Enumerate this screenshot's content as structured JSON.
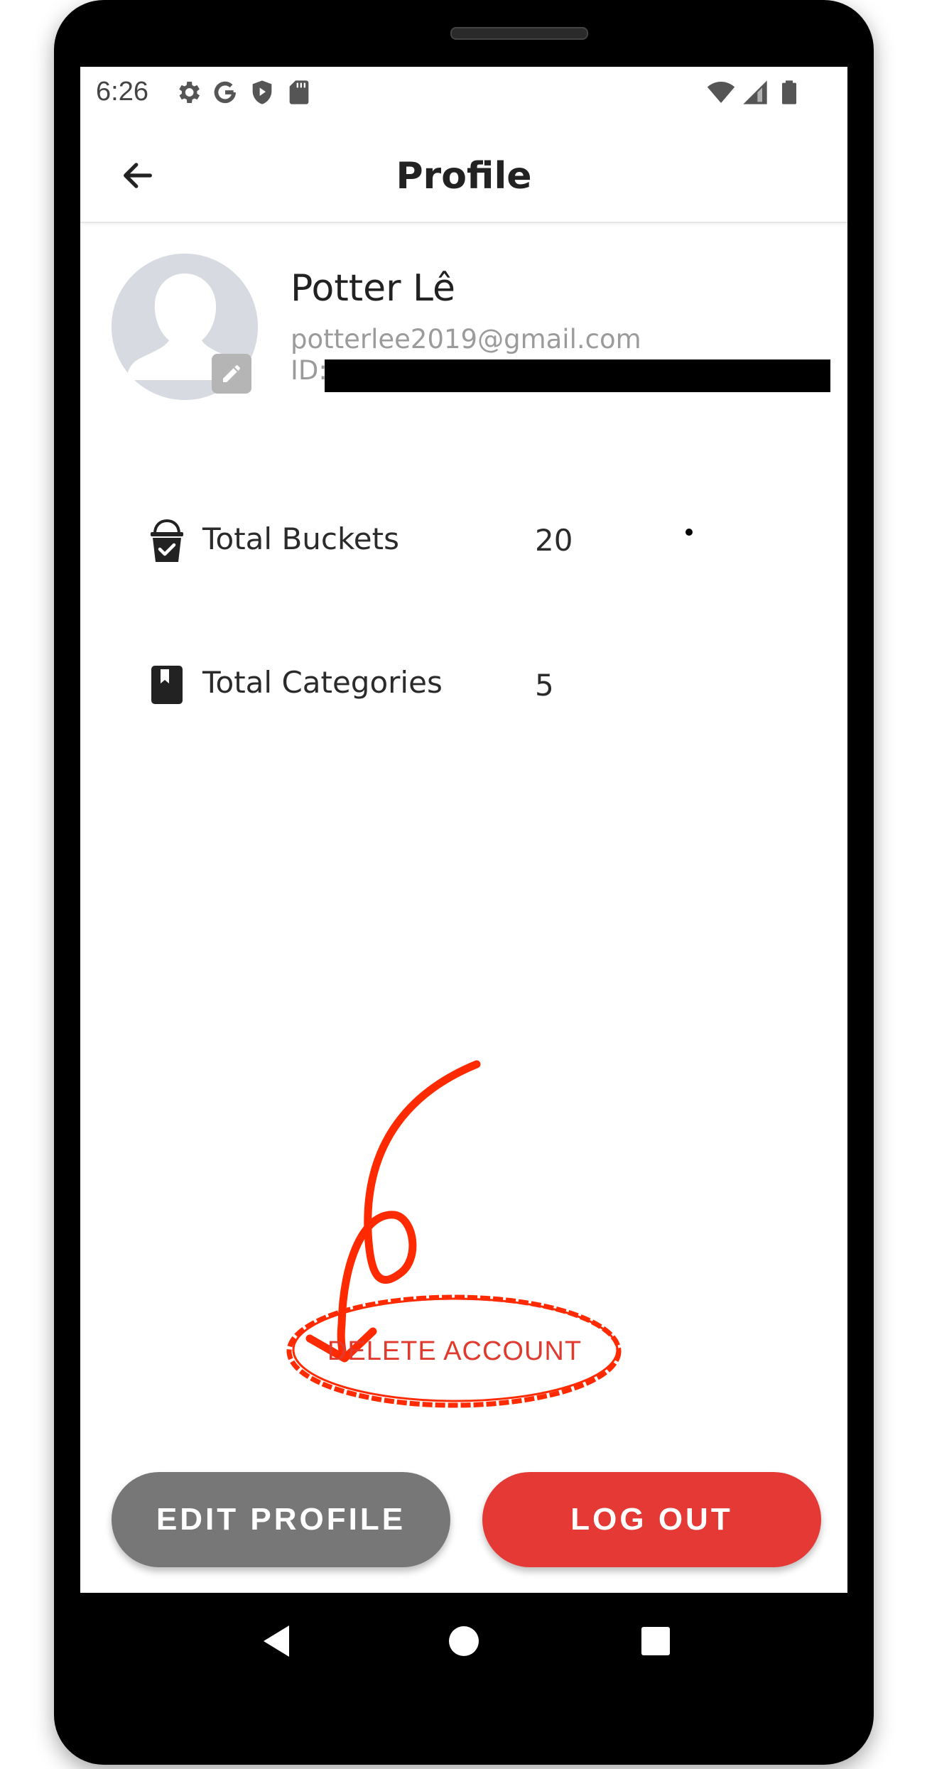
{
  "status_bar": {
    "time": "6:26",
    "left_icons": [
      "gear-icon",
      "google-icon",
      "shield-play-icon",
      "sd-card-icon"
    ],
    "right_icons": [
      "wifi-icon",
      "cell-signal-icon",
      "battery-icon"
    ]
  },
  "app_bar": {
    "title": "Profile",
    "back_icon": "arrow-left-icon"
  },
  "profile": {
    "name": "Potter Lê",
    "email": "potterlee2019@gmail.com",
    "id_label": "ID:"
  },
  "stats": [
    {
      "icon": "bucket-check-icon",
      "label": "Total Buckets",
      "value": "20"
    },
    {
      "icon": "bookmark-book-icon",
      "label": "Total Categories",
      "value": "5"
    }
  ],
  "actions": {
    "delete_account": "DELETE ACCOUNT",
    "edit_profile": "EDIT PROFILE",
    "log_out": "LOG OUT"
  },
  "colors": {
    "accent_red": "#e53935",
    "annotation_red": "#ff2a00",
    "edit_button_gray": "#777777"
  },
  "nav_bar": {
    "icons": [
      "back-triangle-icon",
      "home-circle-icon",
      "recents-square-icon"
    ]
  }
}
